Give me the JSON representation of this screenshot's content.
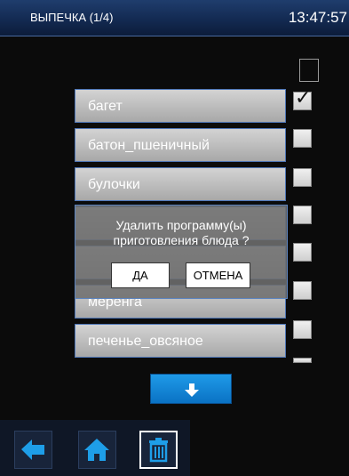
{
  "header": {
    "title": "ВЫПЕЧКА (1/4)",
    "time": "13:47:57"
  },
  "list": {
    "items": [
      {
        "label": "багет",
        "checked": true
      },
      {
        "label": "батон_пшеничный",
        "checked": false
      },
      {
        "label": "булочки",
        "checked": false
      },
      {
        "label": "",
        "checked": false
      },
      {
        "label": "",
        "checked": false
      },
      {
        "label": "меренга",
        "checked": false
      },
      {
        "label": "печенье_овсяное",
        "checked": false
      }
    ]
  },
  "dialog": {
    "message_line1": "Удалить программу(ы)",
    "message_line2": "приготовления блюда ?",
    "yes_label": "ДА",
    "cancel_label": "ОТМЕНА"
  },
  "icons": {
    "scroll": "arrow-down-icon",
    "back": "arrow-left-icon",
    "home": "home-icon",
    "delete": "trash-icon"
  },
  "colors": {
    "header_bg": "#132a52",
    "accent_blue": "#0f86d8",
    "item_border": "#4f77b8"
  }
}
